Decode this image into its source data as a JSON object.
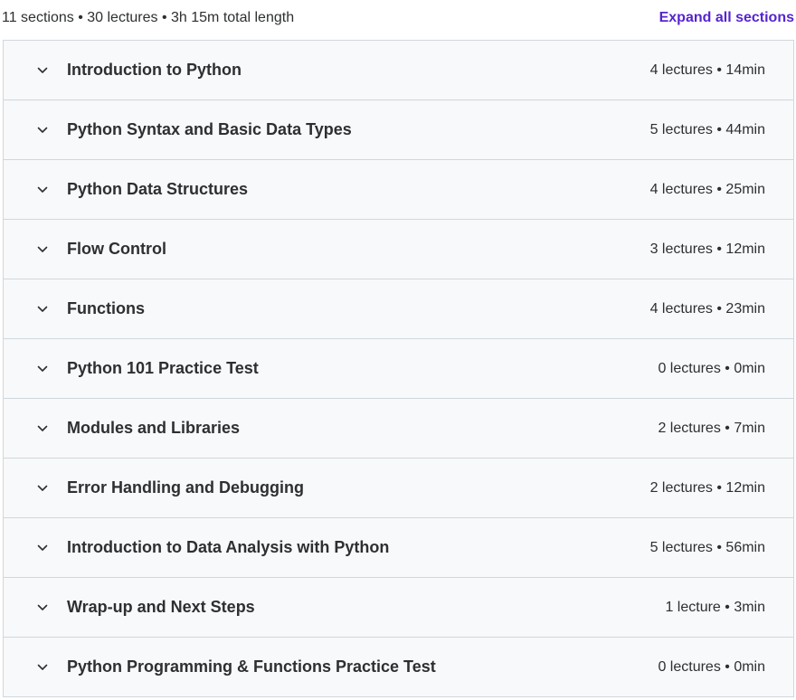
{
  "header": {
    "summary": "11 sections • 30 lectures • 3h 15m total length",
    "expand_label": "Expand all sections",
    "accent_color": "#5624d0"
  },
  "sections": [
    {
      "title": "Introduction to Python",
      "meta": "4 lectures • 14min"
    },
    {
      "title": "Python Syntax and Basic Data Types",
      "meta": "5 lectures • 44min"
    },
    {
      "title": "Python Data Structures",
      "meta": "4 lectures • 25min"
    },
    {
      "title": "Flow Control",
      "meta": "3 lectures • 12min"
    },
    {
      "title": "Functions",
      "meta": "4 lectures • 23min"
    },
    {
      "title": "Python 101 Practice Test",
      "meta": "0 lectures • 0min"
    },
    {
      "title": "Modules and Libraries",
      "meta": "2 lectures • 7min"
    },
    {
      "title": "Error Handling and Debugging",
      "meta": "2 lectures • 12min"
    },
    {
      "title": "Introduction to Data Analysis with Python",
      "meta": "5 lectures • 56min"
    },
    {
      "title": "Wrap-up and Next Steps",
      "meta": "1 lecture • 3min"
    },
    {
      "title": "Python Programming & Functions Practice Test",
      "meta": "0 lectures • 0min"
    }
  ],
  "icons": {
    "section_toggle": "chevron-down-icon"
  }
}
